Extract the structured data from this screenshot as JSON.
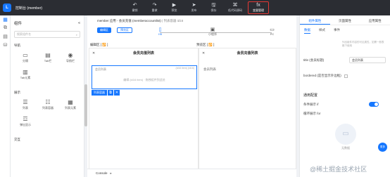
{
  "app": {
    "logo": "L",
    "title": "控制台 (member)"
  },
  "toolbar": [
    {
      "icon": "↶",
      "label": "撤销",
      "highlight": false
    },
    {
      "icon": "↷",
      "label": "重做",
      "highlight": false
    },
    {
      "icon": "▶",
      "label": "预览",
      "highlight": false
    },
    {
      "icon": "➤",
      "label": "发布",
      "highlight": false
    },
    {
      "icon": "🖫",
      "label": "保存",
      "highlight": false
    },
    {
      "icon": "⌘",
      "label": "低代码源码",
      "highlight": false
    },
    {
      "icon": "fx",
      "label": "变量管理",
      "highlight": true
    }
  ],
  "left_panel": {
    "title": "组件",
    "collapse_icon": "«",
    "search_placeholder": "搜索组件名",
    "search_icon": "⌕",
    "sections": [
      {
        "title": "导航",
        "items": [
          {
            "icon": "▭",
            "label": "分隔"
          },
          {
            "icon": "▤",
            "label": "Tab栏"
          },
          {
            "icon": "◉",
            "label": "导航栏"
          },
          {
            "icon": "▥",
            "label": "Tab元素"
          }
        ]
      },
      {
        "title": "展示",
        "items": [
          {
            "icon": "☰",
            "label": "列表"
          },
          {
            "icon": "☷",
            "label": "列表容器"
          },
          {
            "icon": "▦",
            "label": "列表元素"
          },
          {
            "icon": "☲",
            "label": "弹出显示"
          }
        ]
      },
      {
        "title": "交互",
        "items": []
      }
    ]
  },
  "center": {
    "breadcrumb": "member 应用 - 会员充值 (memberaccountlist)",
    "breadcrumb_sub": "列表容器 id16",
    "edit_button": "编辑区",
    "preview_button": "预览区",
    "devices": [
      {
        "icon": "▯",
        "label": "H5",
        "active": true
      },
      {
        "icon": "▣",
        "label": "小程序",
        "active": false
      },
      {
        "icon": "▭",
        "label": "PC",
        "active": false
      }
    ],
    "edit_area_label": "编辑区 [ 🔁 ]",
    "preview_area_label": "预览区 [ 🔁 ]",
    "edit_canvas": {
      "title": "会员充值列表",
      "close_icon": "✕",
      "selected_tag": "会员列表",
      "selected_hint": "(id16 item)\n(id16)",
      "empty_text": "编辑 (id16 item) · 拖拽组件到此处",
      "selected_name": "列表容器",
      "selected_actions": [
        "⧉",
        "✕"
      ]
    },
    "preview_canvas": {
      "title": "会员充值列表",
      "close_icon": "✕",
      "item": "会员列表"
    },
    "console": {
      "label": "Console",
      "icon": "▸"
    }
  },
  "right_panel": {
    "tabs": [
      {
        "label": "组件属性",
        "active": true
      },
      {
        "label": "页面属性",
        "active": false
      },
      {
        "label": "应用属性",
        "active": false
      }
    ],
    "subtabs": [
      {
        "label": "数据",
        "active": true
      },
      {
        "label": "样式",
        "active": false
      },
      {
        "label": "事件",
        "active": false
      }
    ],
    "tip": "列出组件内容的可见属性，如需一般表格下使用",
    "title_field": {
      "label": "title (会员标题)",
      "value": "会员列表"
    },
    "bordered_field": {
      "label": "bordered (是否显示外边框)"
    },
    "section_heading": "通用配置",
    "loop_field": {
      "label": "条件展示 if"
    },
    "loop_for": {
      "label": "循环展示 for"
    },
    "empty": {
      "icon": "▭",
      "text": "无数据"
    }
  },
  "fab": "更多",
  "watermark": "@稀土掘金技术社区",
  "colors": {
    "accent": "#1677ff",
    "highlight_border": "#e53935",
    "topbar": "#2b2d33"
  }
}
